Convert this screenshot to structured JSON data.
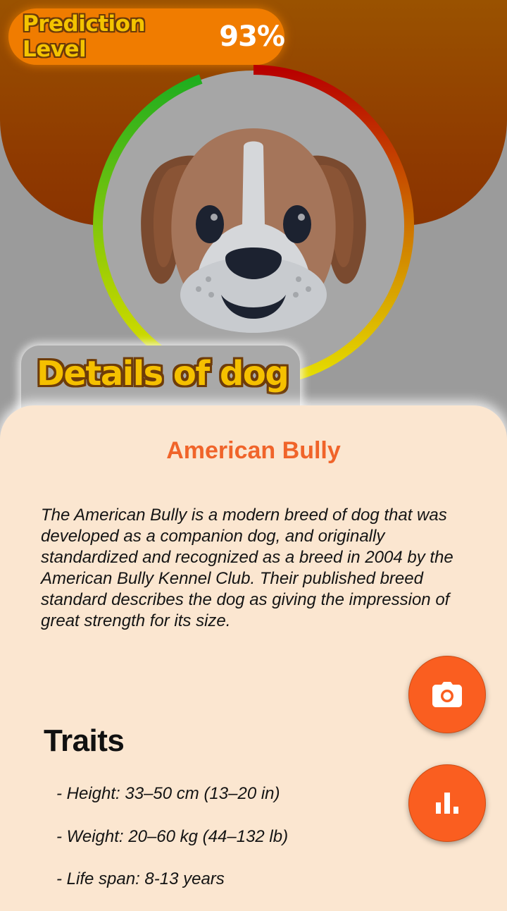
{
  "prediction": {
    "label": "Prediction Level",
    "value": "93%",
    "level": 0.93
  },
  "section": {
    "title": "Details of dog"
  },
  "breed": {
    "name": "American Bully",
    "description": "The American Bully is a modern breed of dog that was developed as a companion dog, and originally standardized and recognized as a breed in 2004 by the American Bully Kennel Club. Their published breed standard describes the dog as giving the impression of great strength for its size."
  },
  "traits": {
    "heading": "Traits",
    "items": [
      "- Height: 33–50 cm (13–20 in)",
      "- Weight: 20–60 kg (44–132 lb)",
      "- Life span: 8-13 years"
    ]
  },
  "actions": {
    "camera_icon": "camera-icon",
    "stats_icon": "bar-chart-icon"
  },
  "colors": {
    "accent": "#fa5e20",
    "header": "#8f3a00",
    "card": "#fbe6d0",
    "gauge_start": "#1fae1f",
    "gauge_mid": "#e6e000",
    "gauge_end": "#b80000"
  }
}
